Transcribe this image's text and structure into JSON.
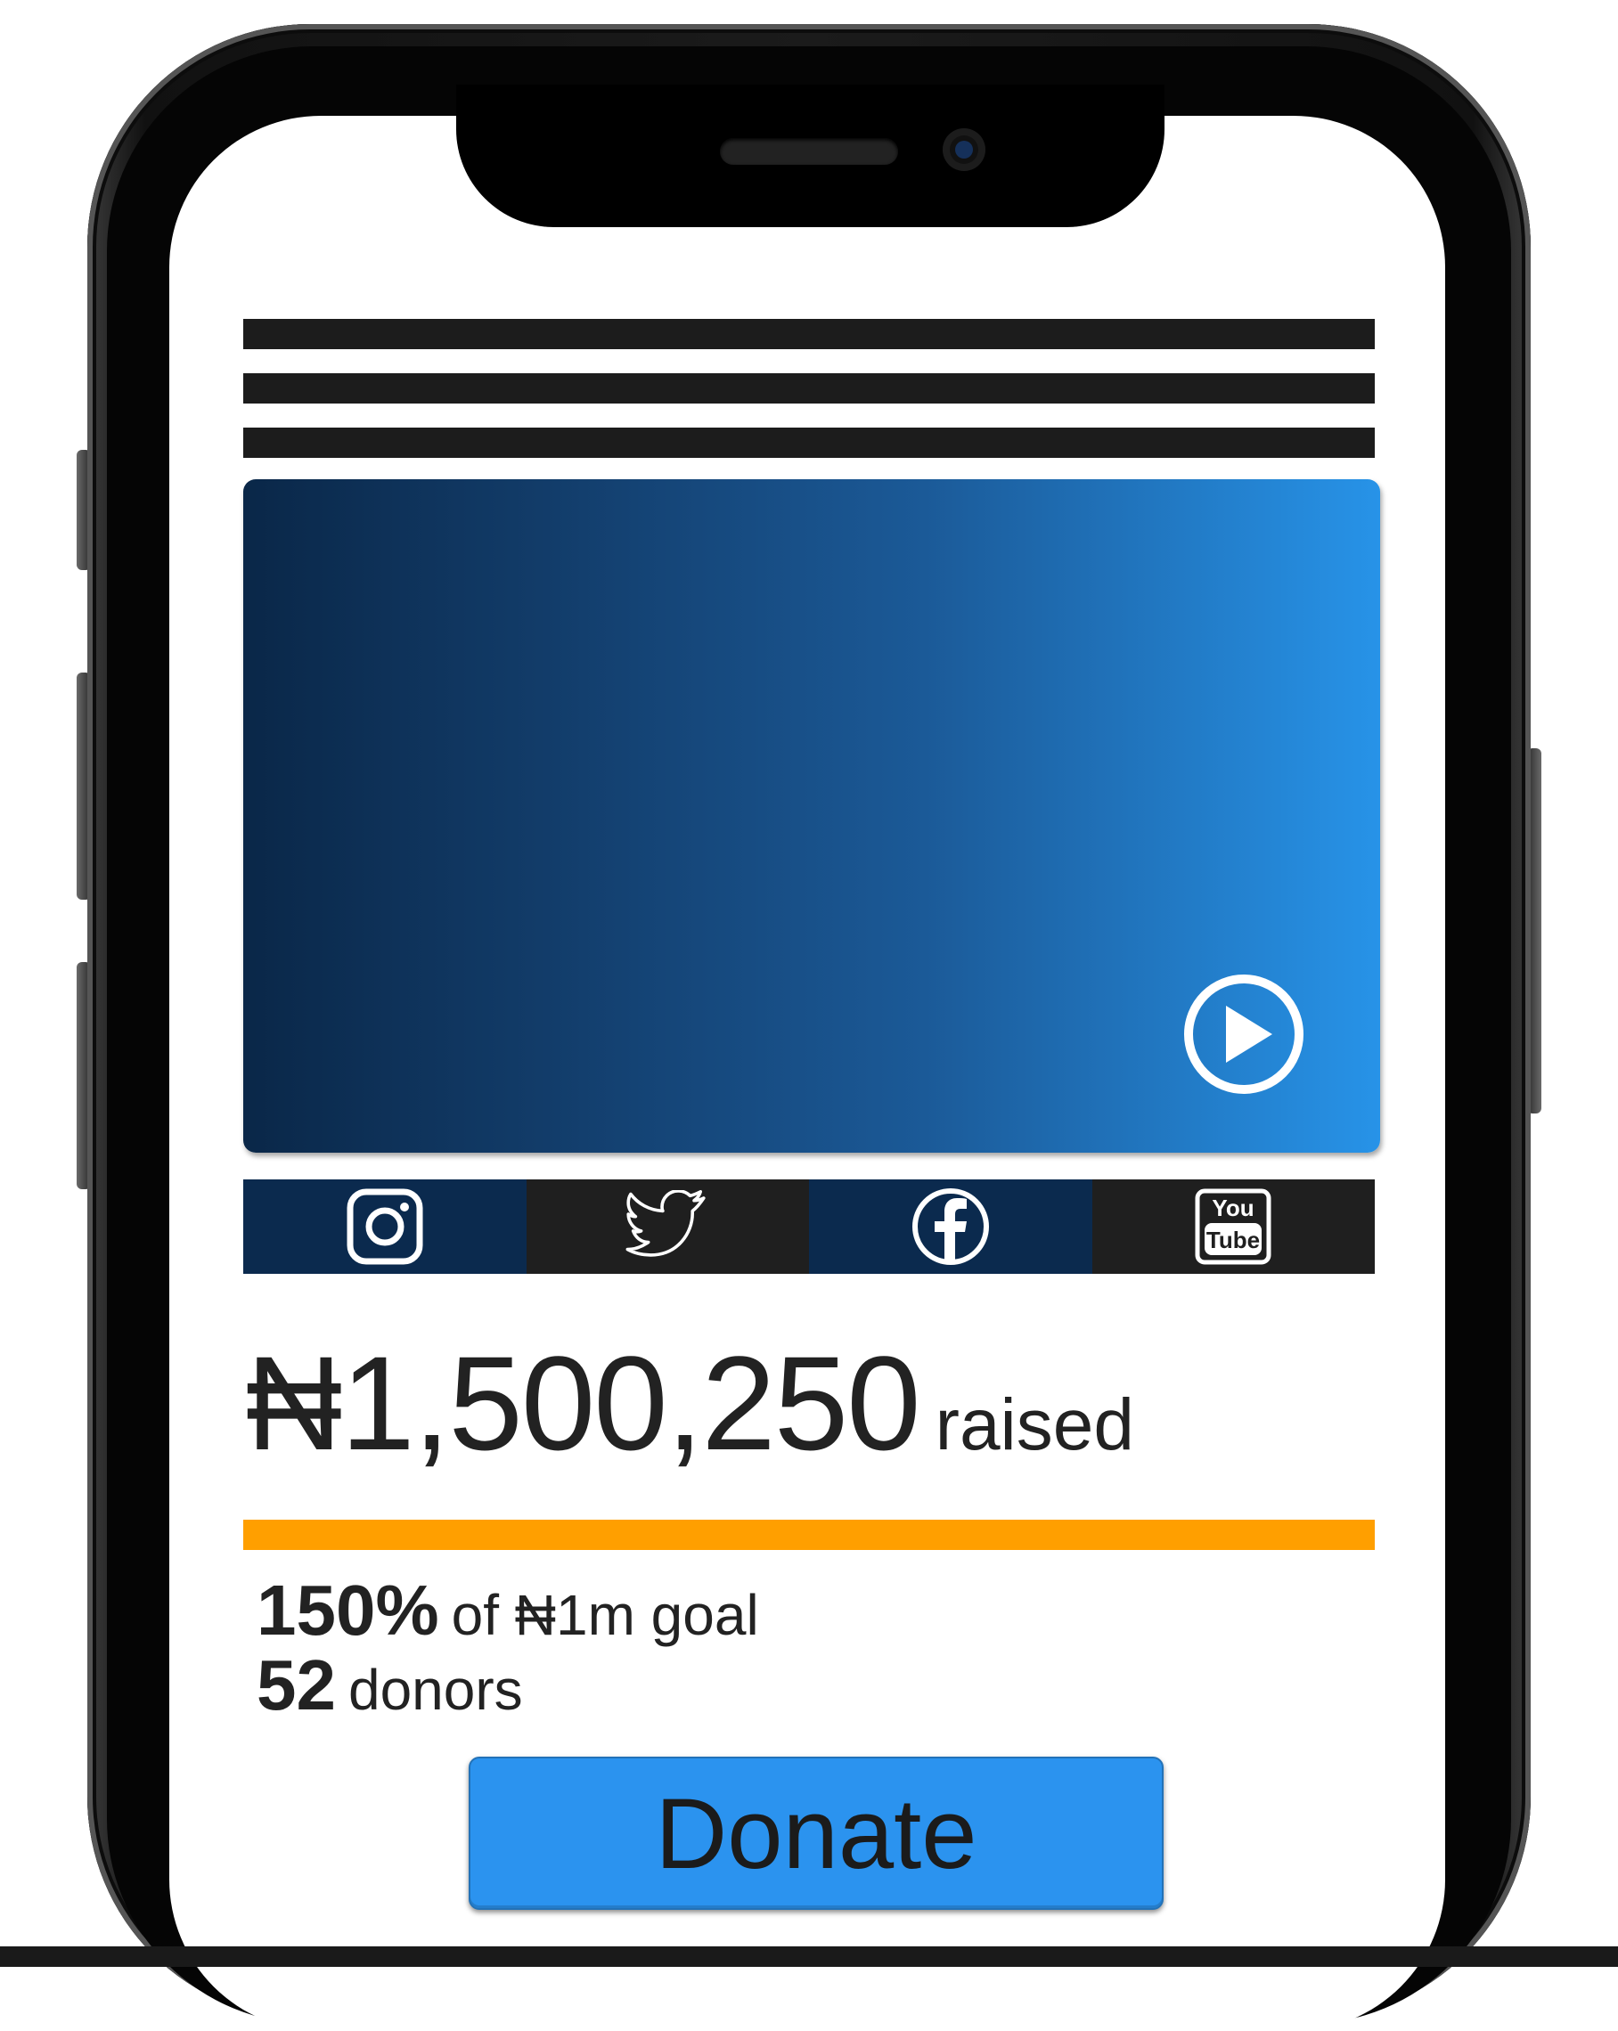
{
  "campaign": {
    "amount_raised": "₦1,500,250",
    "raised_label": "raised",
    "progress_percent": 150,
    "goal_percent_text": "150%",
    "goal_text": "of ₦1m goal",
    "donor_count": "52",
    "donors_text": "donors"
  },
  "donate_button": {
    "label": "Donate"
  },
  "social": [
    "instagram-icon",
    "twitter-icon",
    "facebook-icon",
    "youtube-icon"
  ],
  "youtube_icon": {
    "line1": "You",
    "line2": "Tube"
  },
  "colors": {
    "progress": "#ff9f00",
    "donate_button": "#2b93ef",
    "video_gradient_start": "#0a2748",
    "video_gradient_end": "#2793e8",
    "social_dark_blue": "#0b2a4e",
    "social_dark_gray": "#1f1f1f"
  }
}
